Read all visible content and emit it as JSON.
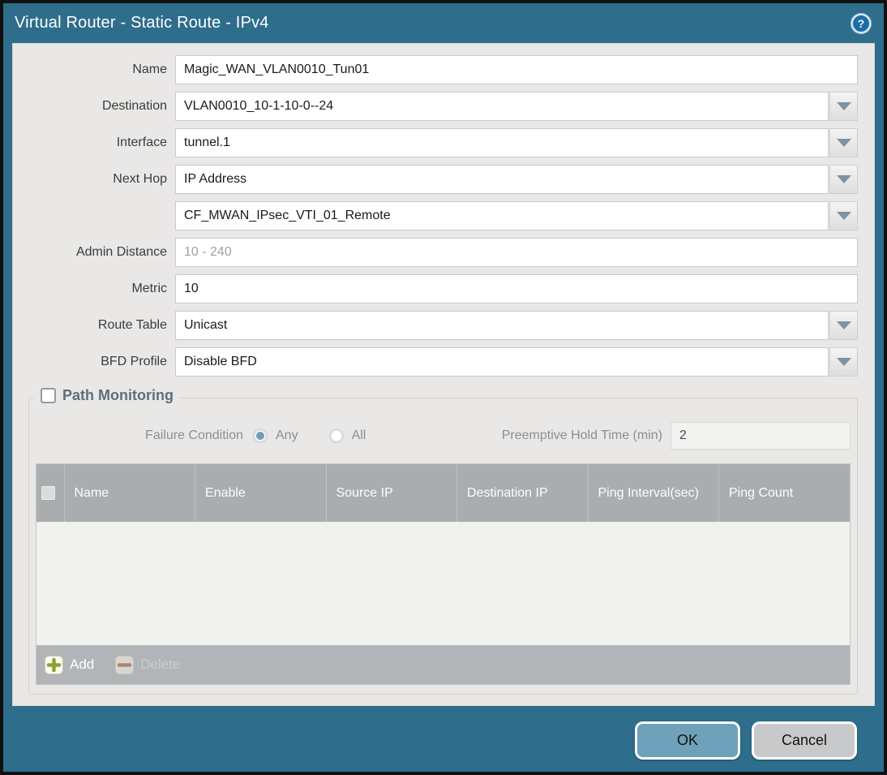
{
  "dialog": {
    "title": "Virtual Router - Static Route - IPv4"
  },
  "form": {
    "name": {
      "label": "Name",
      "value": "Magic_WAN_VLAN0010_Tun01"
    },
    "destination": {
      "label": "Destination",
      "value": "VLAN0010_10-1-10-0--24"
    },
    "interface": {
      "label": "Interface",
      "value": "tunnel.1"
    },
    "next_hop": {
      "label": "Next Hop",
      "value": "IP Address"
    },
    "next_hop_address": {
      "value": "CF_MWAN_IPsec_VTI_01_Remote"
    },
    "admin_distance": {
      "label": "Admin Distance",
      "placeholder": "10 - 240",
      "value": ""
    },
    "metric": {
      "label": "Metric",
      "value": "10"
    },
    "route_table": {
      "label": "Route Table",
      "value": "Unicast"
    },
    "bfd_profile": {
      "label": "BFD Profile",
      "value": "Disable BFD"
    }
  },
  "path_monitoring": {
    "title": "Path Monitoring",
    "enabled": false,
    "failure_condition_label": "Failure Condition",
    "options": {
      "any": "Any",
      "all": "All"
    },
    "selected_option": "Any",
    "preemptive_hold_label": "Preemptive Hold Time (min)",
    "preemptive_hold_value": "2",
    "table": {
      "columns": {
        "name": "Name",
        "enable": "Enable",
        "source_ip": "Source IP",
        "destination_ip": "Destination IP",
        "ping_interval": "Ping Interval(sec)",
        "ping_count": "Ping Count"
      },
      "rows": []
    },
    "add_label": "Add",
    "delete_label": "Delete"
  },
  "footer": {
    "ok_label": "OK",
    "cancel_label": "Cancel"
  },
  "colors": {
    "titlebar": "#2e6d8c",
    "content_bg": "#e9e8e6",
    "table_header": "#aaadaf",
    "ok_button": "#6fa1ba",
    "cancel_button": "#c7c9cb",
    "add_plus": "#8ba32e",
    "delete_minus": "#b06a4a"
  }
}
